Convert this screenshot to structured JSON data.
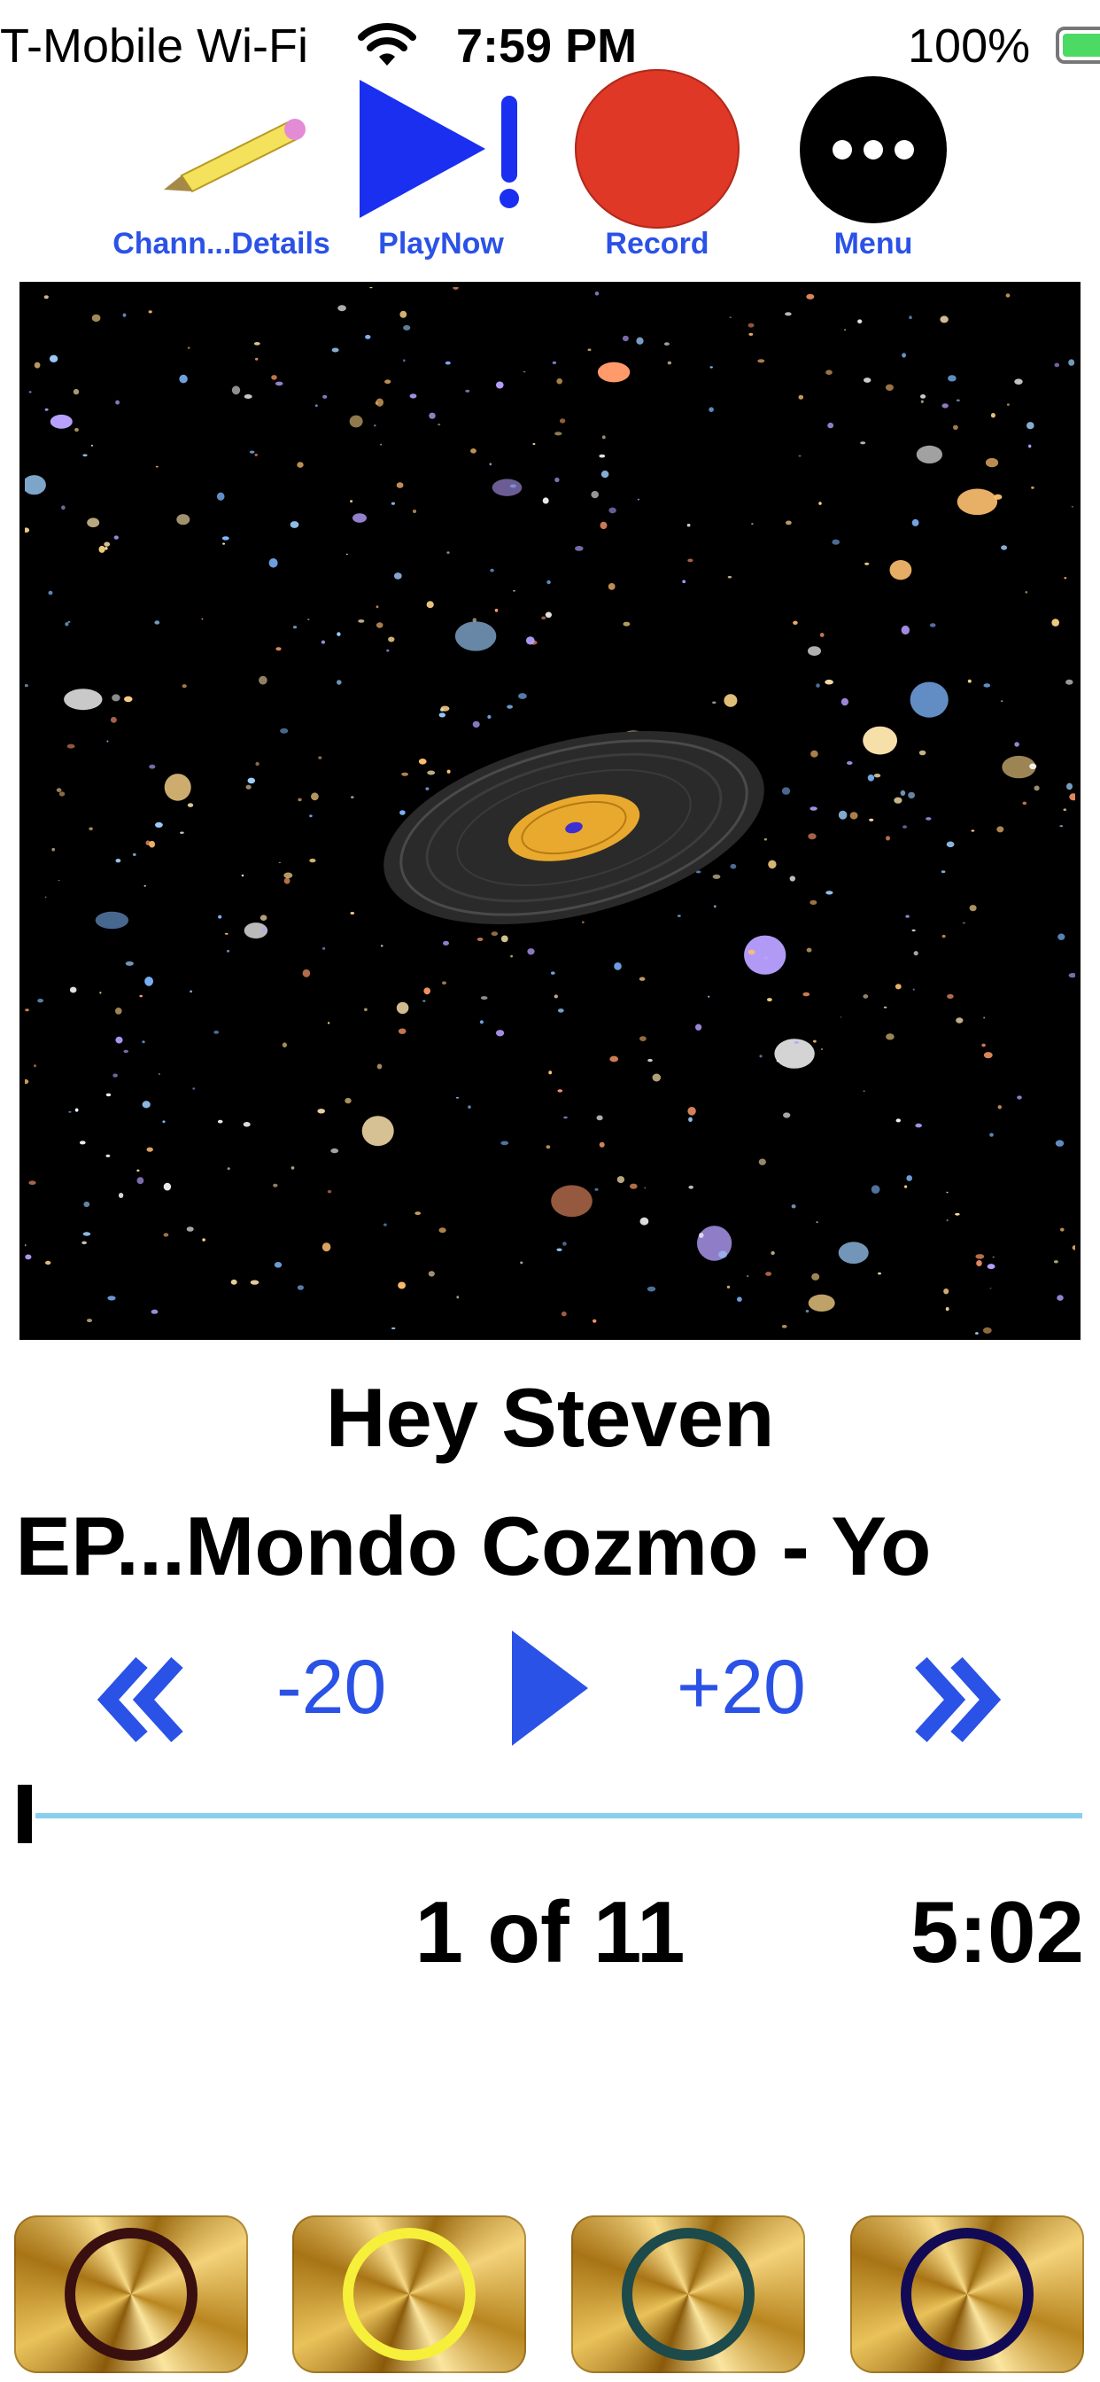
{
  "status_bar": {
    "carrier": "T-Mobile Wi-Fi",
    "time": "7:59 PM",
    "battery_percent": "100%",
    "battery_level": 1.0
  },
  "toolbar": {
    "channel_details": {
      "label": "Chann...Details",
      "icon": "pencil-icon"
    },
    "play_now": {
      "label": "PlayNow",
      "icon": "play-exclamation-icon"
    },
    "record": {
      "label": "Record",
      "icon": "record-icon",
      "color": "#e03826"
    },
    "menu": {
      "label": "Menu",
      "icon": "ellipsis-icon"
    }
  },
  "now_playing": {
    "title": "Hey Steven",
    "subtitle": "EP...Mondo Cozmo - Yo",
    "artwork": "galaxy-vinyl-artwork"
  },
  "transport": {
    "rewind_icon": "chevron-double-left-icon",
    "skip_back_label": "-20",
    "play_icon": "play-icon",
    "skip_forward_label": "+20",
    "fast_forward_icon": "chevron-double-right-icon",
    "accent_color": "#2b52e6"
  },
  "progress": {
    "fraction": 0.0,
    "track_color": "#86d0ee"
  },
  "position": {
    "track_index": "1 of 11",
    "duration": "5:02"
  },
  "preset_buttons": [
    {
      "ring_color": "#3a0f0f",
      "icon": "ring-icon"
    },
    {
      "ring_color": "#f6f03a",
      "icon": "ring-icon"
    },
    {
      "ring_color": "#1d4a4a",
      "icon": "ring-icon"
    },
    {
      "ring_color": "#120a55",
      "icon": "ring-icon"
    }
  ]
}
